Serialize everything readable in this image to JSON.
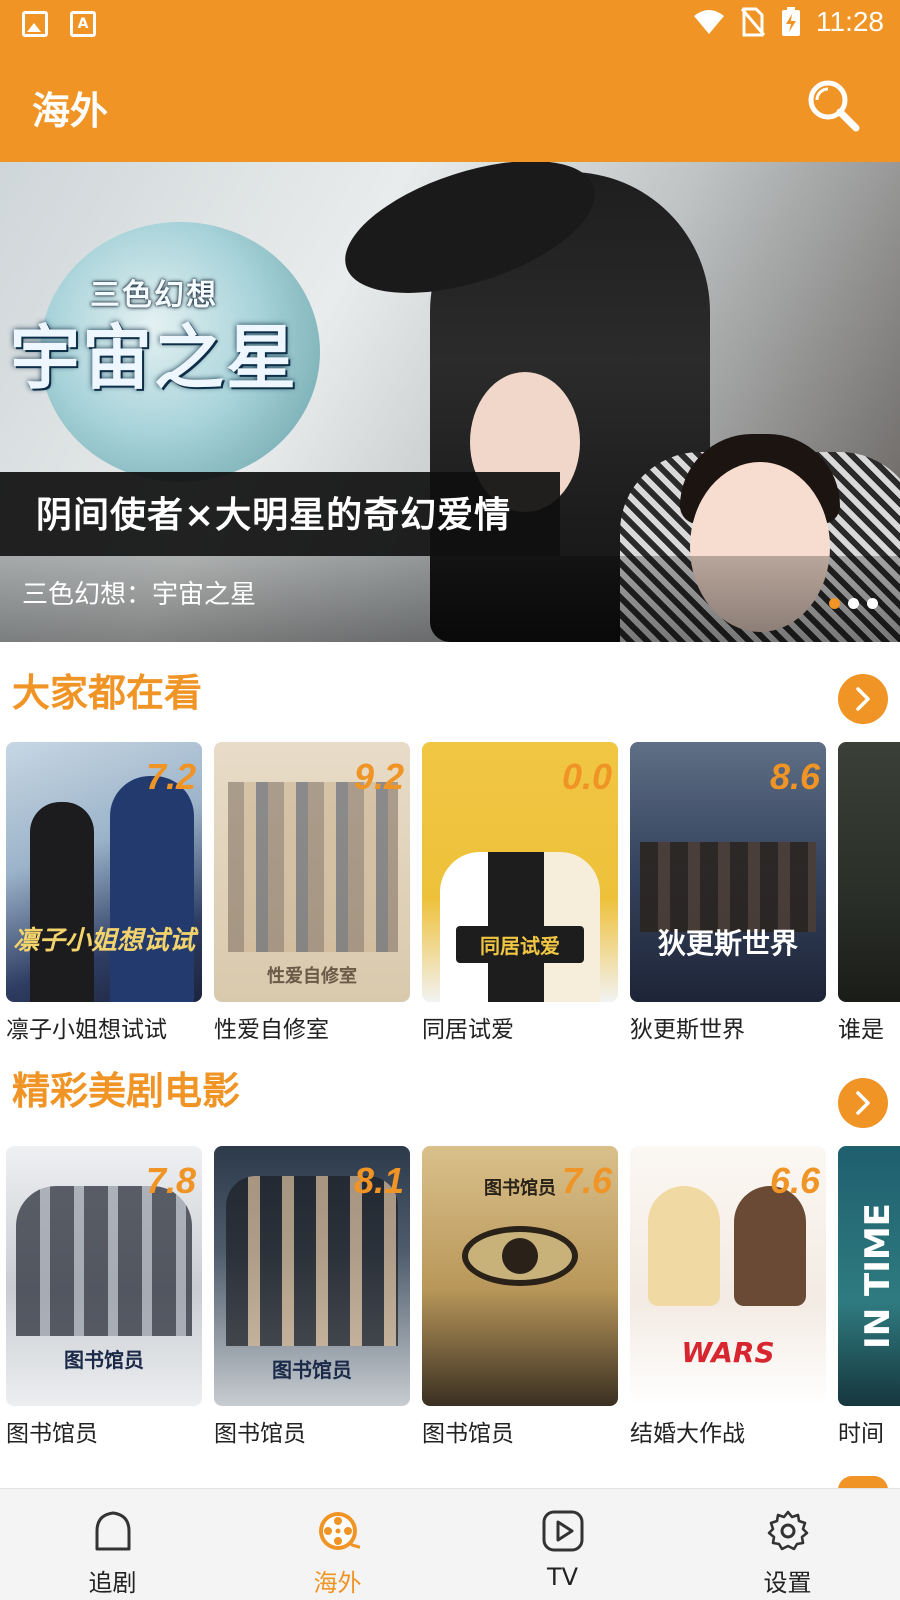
{
  "status_bar": {
    "time": "11:28"
  },
  "app_bar": {
    "title": "海外"
  },
  "banner": {
    "logo_small": "三色幻想",
    "logo_big": "宇宙之星",
    "strip_text": "阴间使者×大明星的奇幻爱情",
    "caption": "三色幻想：宇宙之星",
    "dots": 3,
    "active_dot": 0
  },
  "sections": [
    {
      "title": "大家都在看",
      "items": [
        {
          "name": "凛子小姐想试试",
          "rating": "7.2",
          "poster_text": "凛子小姐想试试"
        },
        {
          "name": "性爱自修室",
          "rating": "9.2",
          "poster_text": "性爱自修室"
        },
        {
          "name": "同居试爱",
          "rating": "0.0",
          "poster_text": "同居试爱"
        },
        {
          "name": "狄更斯世界",
          "rating": "8.6",
          "poster_text": "狄更斯世界"
        },
        {
          "name": "谁是",
          "rating": "",
          "poster_text": ""
        }
      ]
    },
    {
      "title": "精彩美剧电影",
      "items": [
        {
          "name": "图书馆员",
          "rating": "7.8",
          "poster_text": "图书馆员"
        },
        {
          "name": "图书馆员",
          "rating": "8.1",
          "poster_text": "图书馆员"
        },
        {
          "name": "图书馆员",
          "rating": "7.6",
          "poster_text": "图书馆员"
        },
        {
          "name": "结婚大作战",
          "rating": "6.6",
          "poster_text": "WARS"
        },
        {
          "name": "时间",
          "rating": "",
          "poster_text": "IN TIME"
        }
      ]
    }
  ],
  "bottom_nav": {
    "tabs": [
      {
        "label": "追剧",
        "icon": "house-icon"
      },
      {
        "label": "海外",
        "icon": "film-reel-icon"
      },
      {
        "label": "TV",
        "icon": "play-icon"
      },
      {
        "label": "设置",
        "icon": "gear-icon"
      }
    ],
    "active_index": 1
  },
  "colors": {
    "accent": "#EF9425",
    "text": "#222222",
    "nav_bg": "#f4f4f4"
  }
}
